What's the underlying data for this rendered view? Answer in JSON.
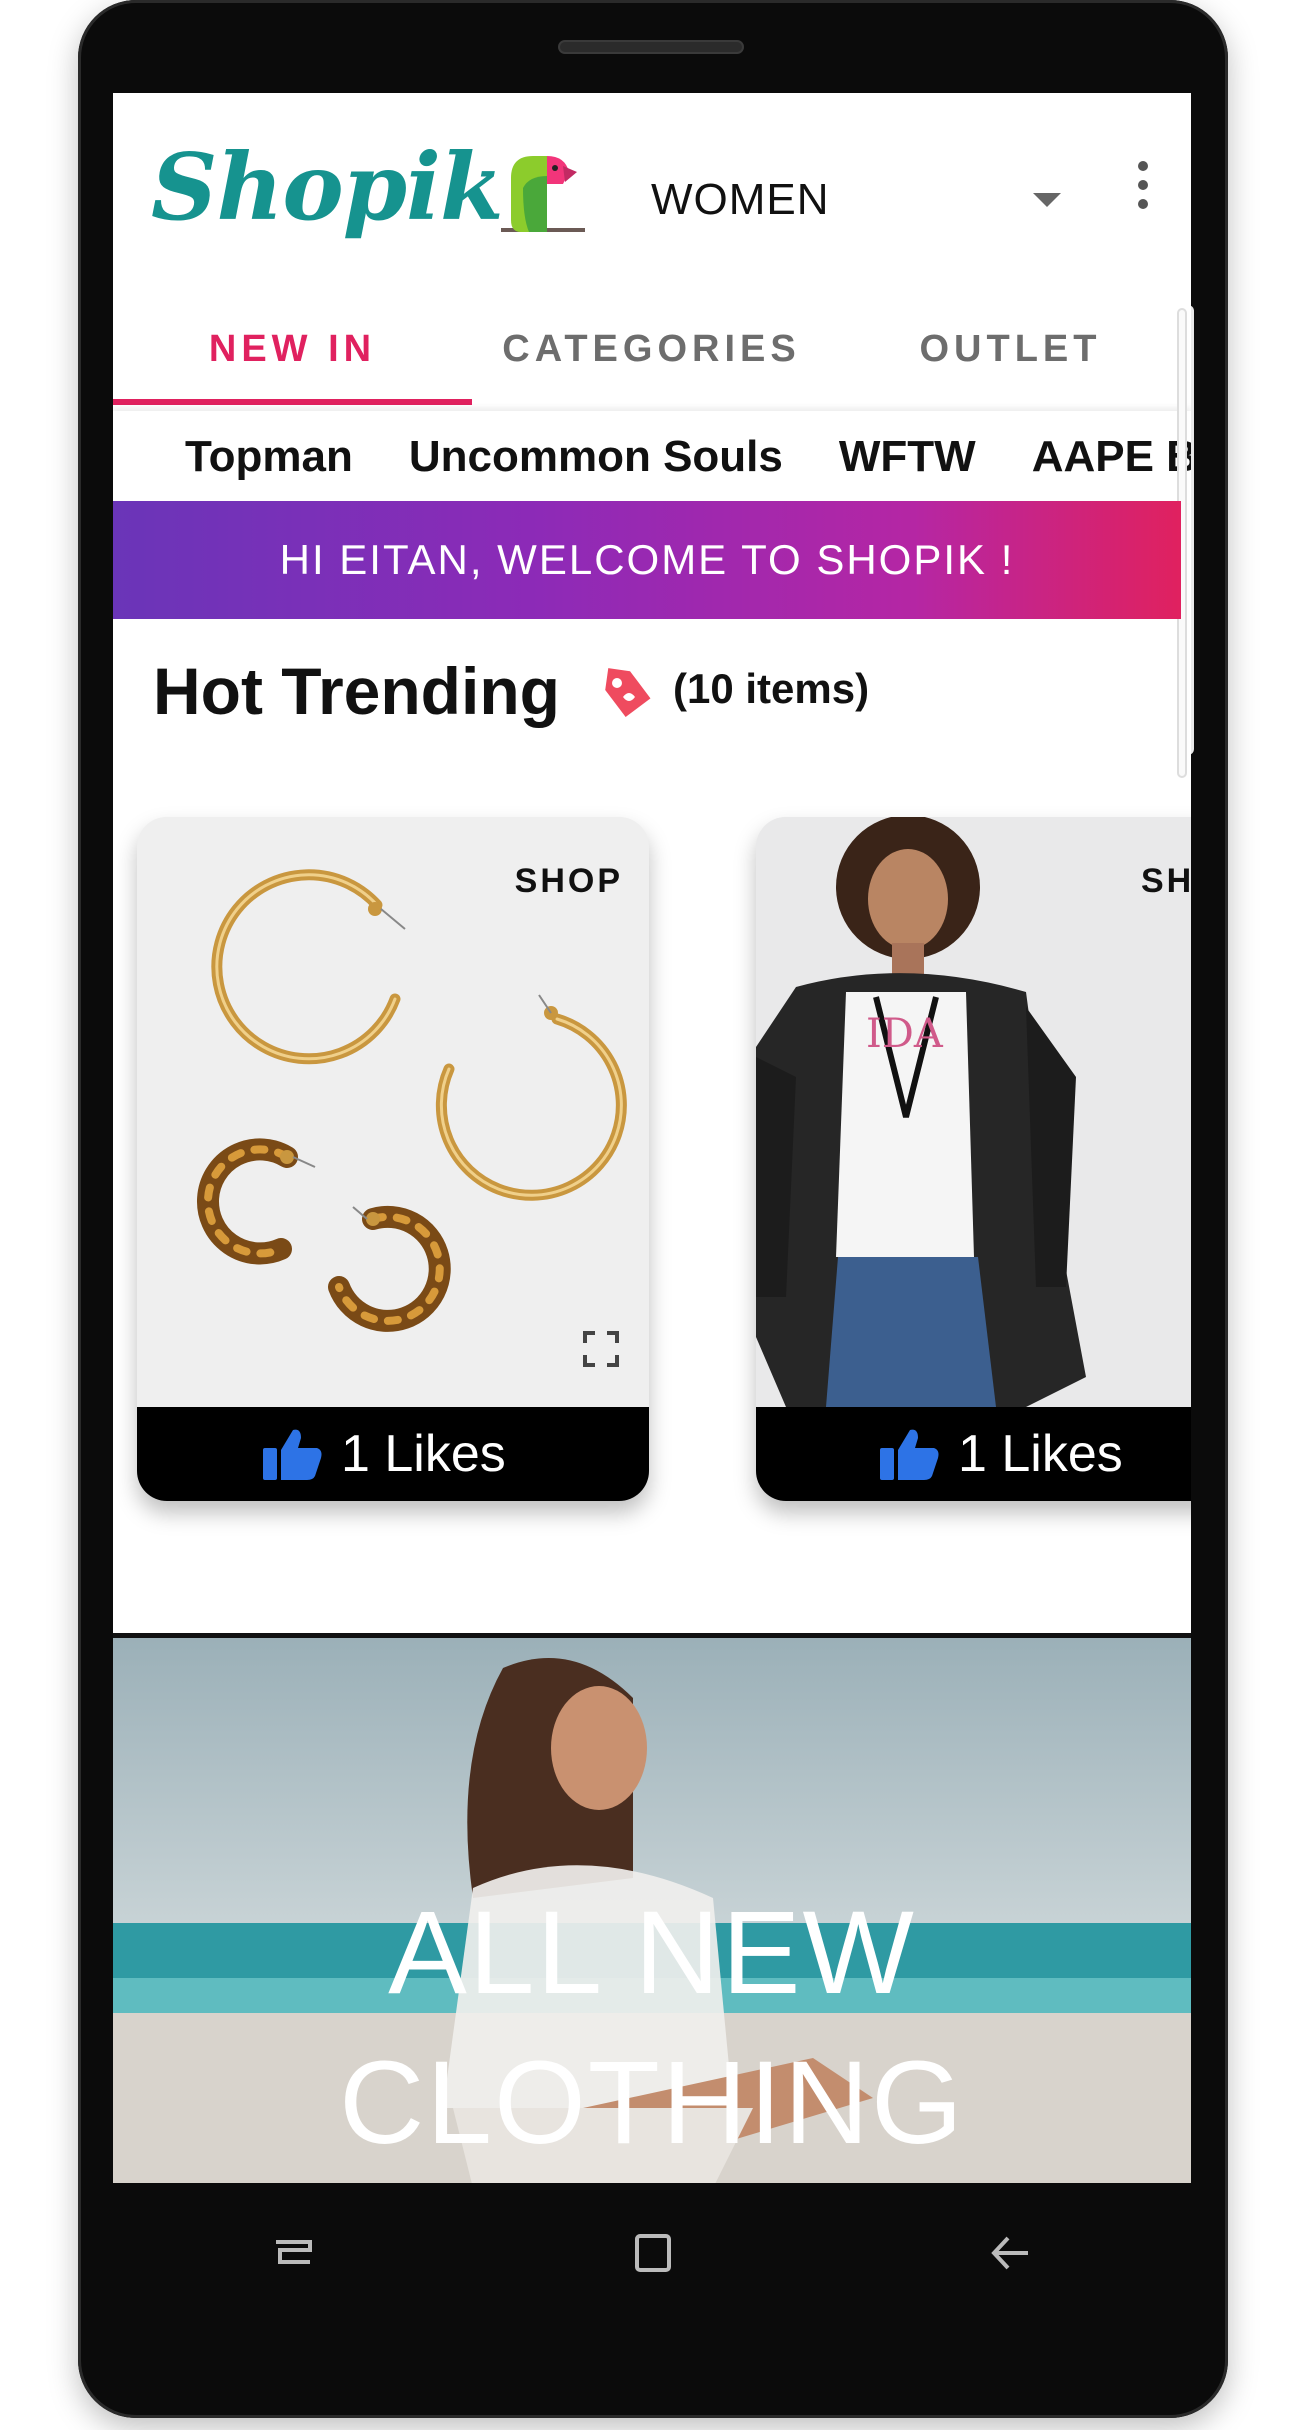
{
  "app": {
    "logo_text": "Shopik"
  },
  "header": {
    "category_selected": "WOMEN"
  },
  "tabs": [
    {
      "label": "NEW IN",
      "active": true
    },
    {
      "label": "CATEGORIES",
      "active": false
    },
    {
      "label": "OUTLET",
      "active": false
    }
  ],
  "brands": [
    "Topman",
    "Uncommon Souls",
    "WFTW",
    "AAPE B"
  ],
  "welcome_banner": "HI EITAN, WELCOME TO SHOPIK !",
  "hot_trending": {
    "title": "Hot Trending",
    "count_label": "(10 items)",
    "products": [
      {
        "shop_label": "SHOP",
        "likes": "1 Likes"
      },
      {
        "shop_label": "SHO",
        "likes": "1 Likes"
      }
    ]
  },
  "promo": {
    "line1": "ALL NEW",
    "line2": "CLOTHING"
  },
  "colors": {
    "accent": "#e0215f",
    "logo": "#16938f",
    "like_icon": "#2d73e6"
  }
}
